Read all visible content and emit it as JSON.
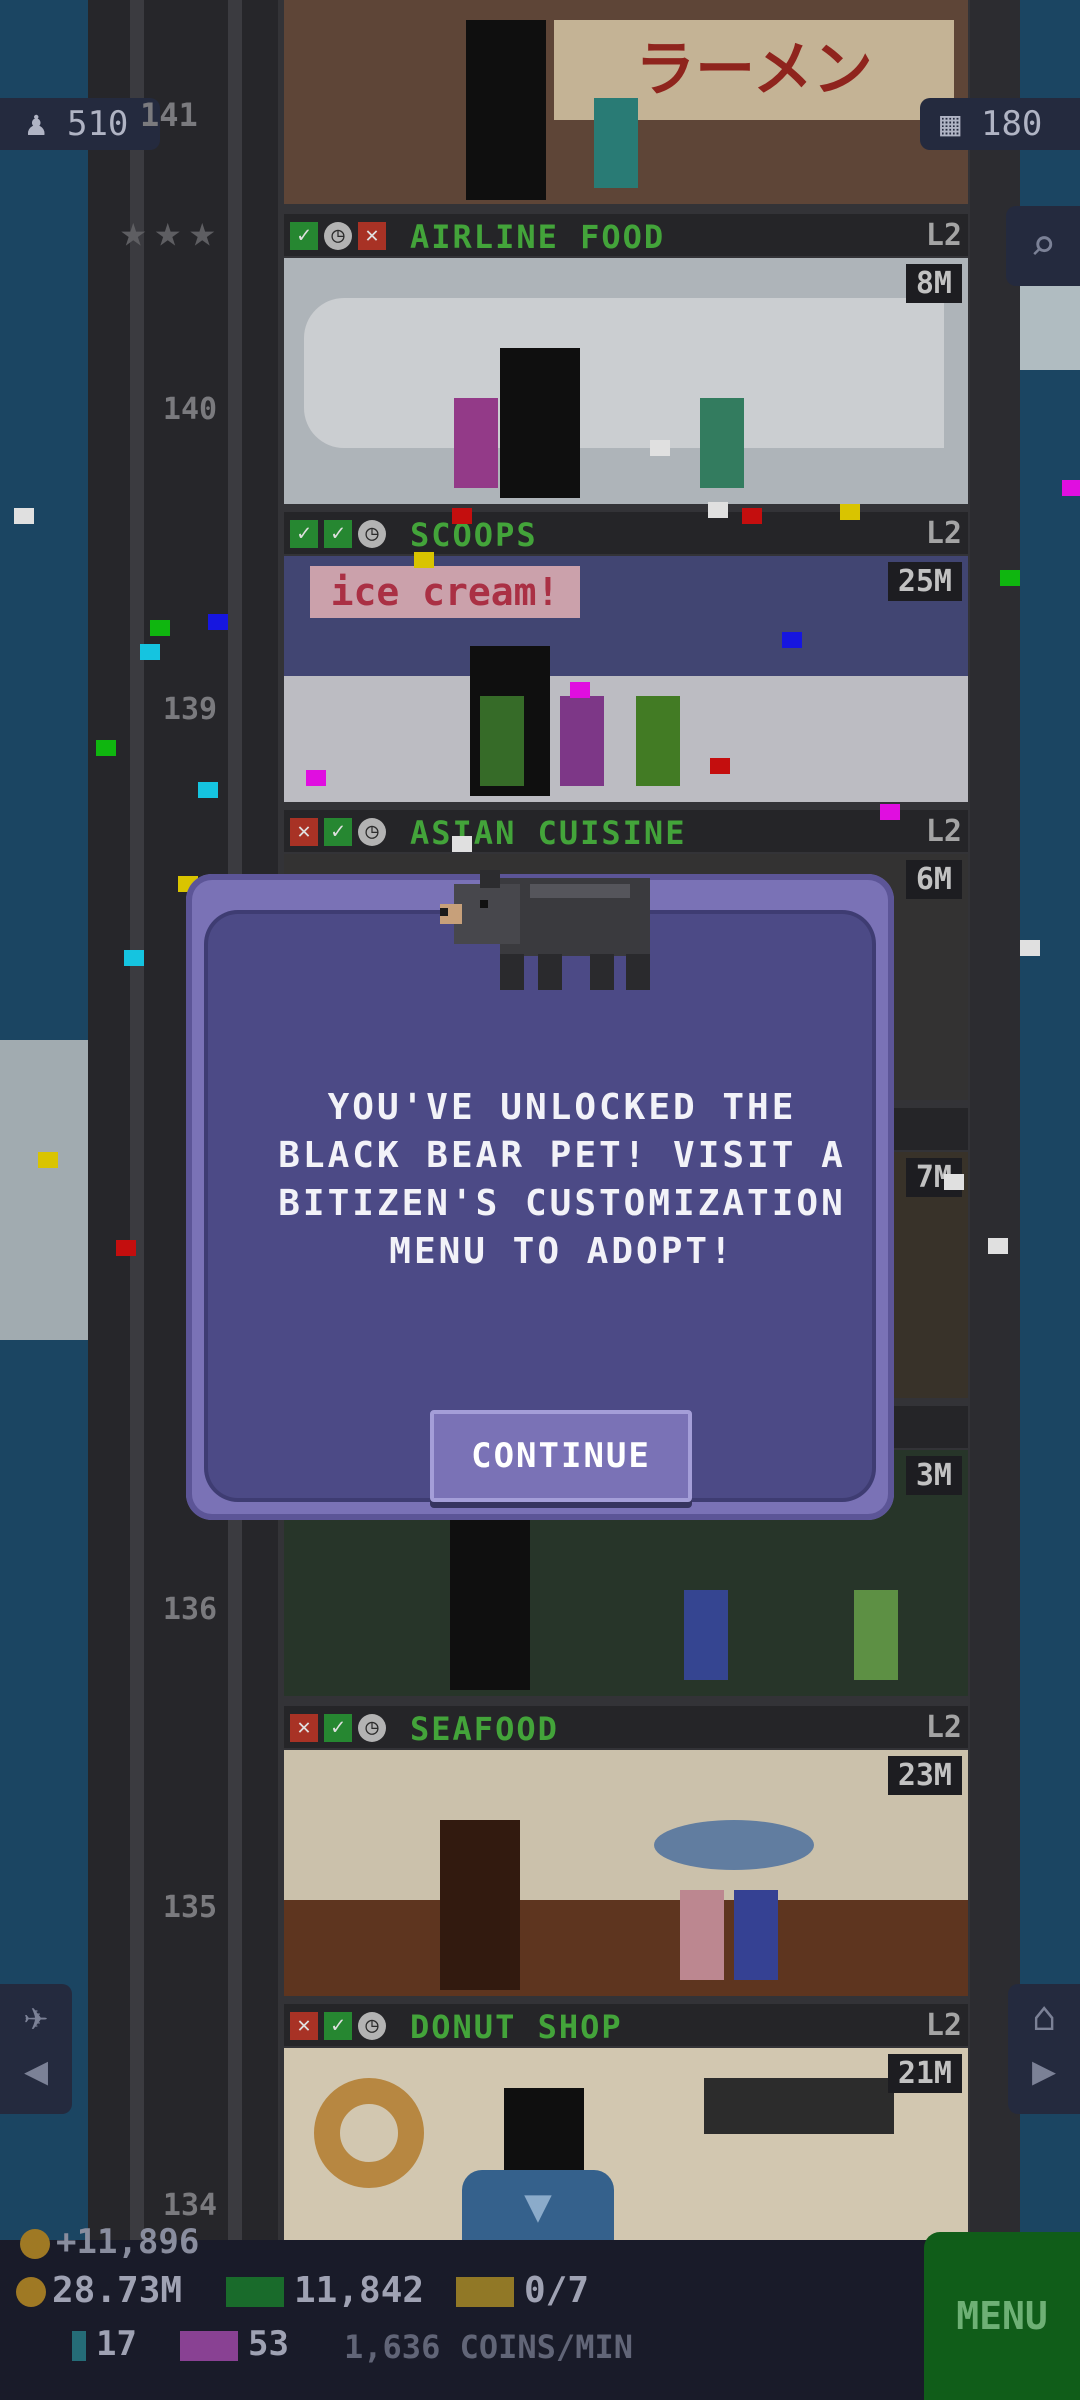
{
  "hud": {
    "population": "510",
    "floor_count": "180",
    "top_floor_label": "141"
  },
  "floor_numbers": [
    "140",
    "139",
    "136",
    "135",
    "134"
  ],
  "floors": [
    {
      "name": "AIRLINE FOOD",
      "level": "L2",
      "stock": "8M"
    },
    {
      "name": "SCOOPS",
      "level": "L2",
      "stock": "25M",
      "sign": "ice cream!"
    },
    {
      "name": "ASIAN CUISINE",
      "level": "L2",
      "stock": "6M"
    },
    {
      "name": "SEAFOOD",
      "level": "L2",
      "stock": "23M"
    },
    {
      "name": "DONUT SHOP",
      "level": "L2",
      "stock": "21M"
    }
  ],
  "partial_stocks": [
    "7M",
    "3M"
  ],
  "ramen_sign": "ラーメン",
  "modal": {
    "message": "YOU'VE UNLOCKED THE BLACK BEAR PET! VISIT A BITIZEN'S CUSTOMIZATION MENU TO ADOPT!",
    "button_label": "CONTINUE"
  },
  "bottom": {
    "coin_gain": "+11,896",
    "coins": "28.73M",
    "bux": "11,842",
    "tickets": "0/7",
    "keys": "17",
    "gold_tickets": "53",
    "coins_rate": "1,636 COINS/MIN",
    "menu_label": "MENU"
  },
  "icons": {
    "population": "person-icon",
    "floors": "building-icon",
    "search": "magnifier-icon",
    "elevator": "person-arrow-icon",
    "home": "house-arrow-icon",
    "scroll": "down-arrow-icon"
  }
}
